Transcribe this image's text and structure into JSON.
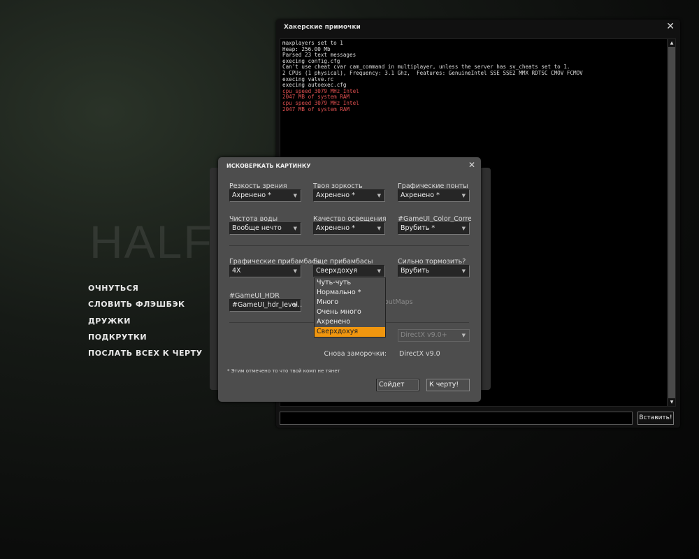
{
  "background": {
    "logo": "HALF-LIFE"
  },
  "main_menu": [
    "ОЧНУТЬСЯ",
    "СЛОВИТЬ ФЛЭШБЭК",
    "ДРУЖКИ",
    "ПОДКРУТКИ",
    "ПОСЛАТЬ ВСЕХ К ЧЕРТУ"
  ],
  "console": {
    "title": "Хакерские примочки",
    "close": "✕",
    "lines": [
      {
        "text": "maxplayers set to 1",
        "color": "normal"
      },
      {
        "text": "Heap: 256.00 Mb",
        "color": "normal"
      },
      {
        "text": "Parsed 23 text messages",
        "color": "normal"
      },
      {
        "text": "execing config.cfg",
        "color": "normal"
      },
      {
        "text": "Can't use cheat cvar cam_command in multiplayer, unless the server has sv_cheats set to 1.",
        "color": "normal"
      },
      {
        "text": "2 CPUs (1 physical), Frequency: 3.1 Ghz,  Features: GenuineIntel SSE SSE2 MMX RDTSC CMOV FCMOV",
        "color": "normal"
      },
      {
        "text": "execing valve.rc",
        "color": "normal"
      },
      {
        "text": "execing autoexec.cfg",
        "color": "normal"
      },
      {
        "text": "cpu speed 3079 MHz Intel",
        "color": "red"
      },
      {
        "text": "2047 MB of system RAM",
        "color": "red"
      },
      {
        "text": "cpu speed 3079 MHz Intel",
        "color": "red"
      },
      {
        "text": "2047 MB of system RAM",
        "color": "red"
      }
    ],
    "input_value": "",
    "submit": "Вставить!"
  },
  "dialog": {
    "title": "ИСКОВЕРКАТЬ КАРТИНКУ",
    "close": "✕",
    "fields": [
      {
        "label": "Резкость зрения",
        "value": "Ахренено *"
      },
      {
        "label": "Твоя зоркость",
        "value": "Ахренено *"
      },
      {
        "label": "Графические понты",
        "value": "Ахренено *"
      },
      {
        "label": "Чистота воды",
        "value": "Вообще нечто"
      },
      {
        "label": "Качество освещения",
        "value": "Ахренено *"
      },
      {
        "label": "#GameUI_Color_Correc",
        "value": "Врубить *"
      },
      {
        "label": "Графические прибамбасы",
        "value": "4X"
      },
      {
        "label": "Еще прибамбасы",
        "value": "Сверхдохуя"
      },
      {
        "label": "Сильно тормозить?",
        "value": "Врубить"
      },
      {
        "label": "#GameUI_HDR",
        "value": "#GameUI_hdr_level.."
      }
    ],
    "partial_text": "outMaps",
    "directx_combo": "DirectX v9.0+",
    "dx_label": "Снова заморочки:",
    "dx_value": "DirectX v9.0",
    "footnote": "* Этим отмечено то что твой комп не тянет",
    "ok": "Сойдет",
    "cancel": "К черту!",
    "dropdown": {
      "options": [
        "Чуть-чуть",
        "Нормально *",
        "Много",
        "Очень много",
        "Ахренено",
        "Сверхдохуя"
      ],
      "selected_index": 5
    }
  }
}
